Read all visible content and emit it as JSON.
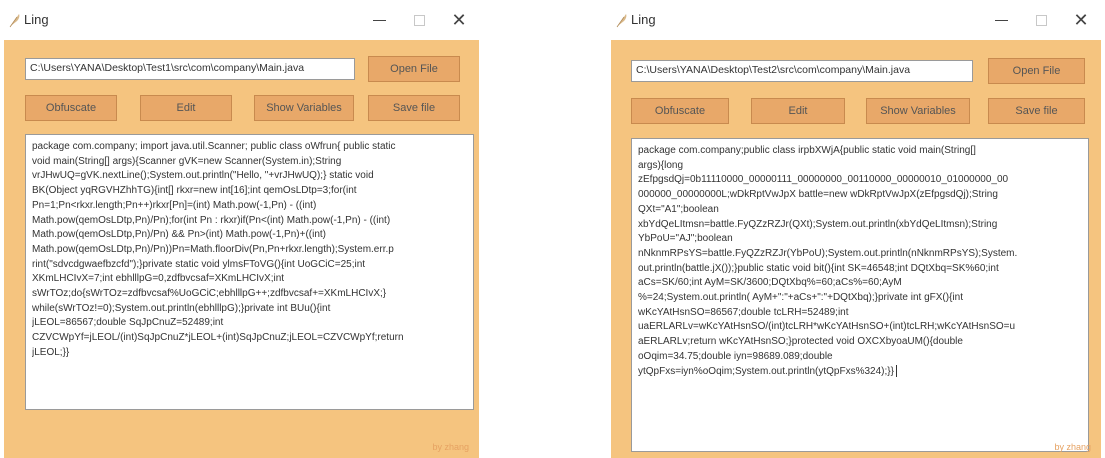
{
  "windows": [
    {
      "title": "Ling",
      "file_path": "C:\\Users\\YANA\\Desktop\\Test1\\src\\com\\company\\Main.java",
      "buttons": {
        "open_file": "Open File",
        "obfuscate": "Obfuscate",
        "edit": "Edit",
        "show_variables": "Show Variables",
        "save_file": "Save file"
      },
      "code_lines": [
        "package com.company; import java.util.Scanner; public class oWfrun{ public static",
        "void main(String[] args){Scanner gVK=new Scanner(System.in);String",
        "vrJHwUQ=gVK.nextLine();System.out.println(\"Hello, \"+vrJHwUQ);} static void",
        "BK(Object yqRGVHZhhTG){int[] rkxr=new int[16];int qemOsLDtp=3;for(int",
        "Pn=1;Pn<rkxr.length;Pn++)rkxr[Pn]=(int) Math.pow(-1,Pn) - ((int)",
        "Math.pow(qemOsLDtp,Pn)/Pn);for(int Pn : rkxr)if(Pn<(int) Math.pow(-1,Pn) - ((int)",
        "Math.pow(qemOsLDtp,Pn)/Pn) && Pn>(int) Math.pow(-1,Pn)+((int)",
        "Math.pow(qemOsLDtp,Pn)/Pn))Pn=Math.floorDiv(Pn,Pn+rkxr.length);System.err.p",
        "rint(\"sdvcdgwaefbzcfd\");}private static void ylmsFToVG(){int UoGCiC=25;int",
        "XKmLHCIvX=7;int ebhlllpG=0,zdfbvcsaf=XKmLHCIvX;int",
        "sWrTOz;do{sWrTOz=zdfbvcsaf%UoGCiC;ebhlllpG++;zdfbvcsaf+=XKmLHCIvX;}",
        "while(sWrTOz!=0);System.out.println(ebhlllpG);}private int BUu(){int",
        "jLEOL=86567;double SqJpCnuZ=52489;int",
        "CZVCWpYf=jLEOL/(int)SqJpCnuZ*jLEOL+(int)SqJpCnuZ;jLEOL=CZVCWpYf;return",
        "jLEOL;}}"
      ],
      "footer": "by zhang"
    },
    {
      "title": "Ling",
      "file_path": "C:\\Users\\YANA\\Desktop\\Test2\\src\\com\\company\\Main.java",
      "buttons": {
        "open_file": "Open File",
        "obfuscate": "Obfuscate",
        "edit": "Edit",
        "show_variables": "Show Variables",
        "save_file": "Save file"
      },
      "code_lines": [
        "package com.company;public class irpbXWjA{public static void main(String[]",
        "args){long",
        "zEfpgsdQj=0b11110000_00000111_00000000_00110000_00000010_01000000_00",
        "000000_00000000L;wDkRptVwJpX battle=new wDkRptVwJpX(zEfpgsdQj);String",
        "QXt=\"A1\";boolean",
        "xbYdQeLItmsn=battle.FyQZzRZJr(QXt);System.out.println(xbYdQeLItmsn);String",
        "YbPoU=\"AJ\";boolean",
        "nNknmRPsYS=battle.FyQZzRZJr(YbPoU);System.out.println(nNknmRPsYS);System.",
        "out.println(battle.jX());}public static void bit(){int SK=46548;int DQtXbq=SK%60;int",
        "aCs=SK/60;int AyM=SK/3600;DQtXbq%=60;aCs%=60;AyM",
        "%=24;System.out.println( AyM+\":\"+aCs+\":\"+DQtXbq);}private int gFX(){int",
        "wKcYAtHsnSO=86567;double tcLRH=52489;int",
        "uaERLARLv=wKcYAtHsnSO/(int)tcLRH*wKcYAtHsnSO+(int)tcLRH;wKcYAtHsnSO=u",
        "aERLARLv;return wKcYAtHsnSO;}protected void OXCXbyoaUM(){double",
        "oOqim=34.75;double iyn=98689.089;double",
        "ytQpFxs=iyn%oOqim;System.out.println(ytQpFxs%324);}}"
      ],
      "footer": "by zhang"
    }
  ],
  "colors": {
    "background": "#f5c47f",
    "button": "#e8a869",
    "footer_text": "#e6a262"
  },
  "icons": {
    "app": "feather-icon",
    "minimize": "minimize-icon",
    "maximize": "maximize-icon",
    "close": "close-icon"
  }
}
